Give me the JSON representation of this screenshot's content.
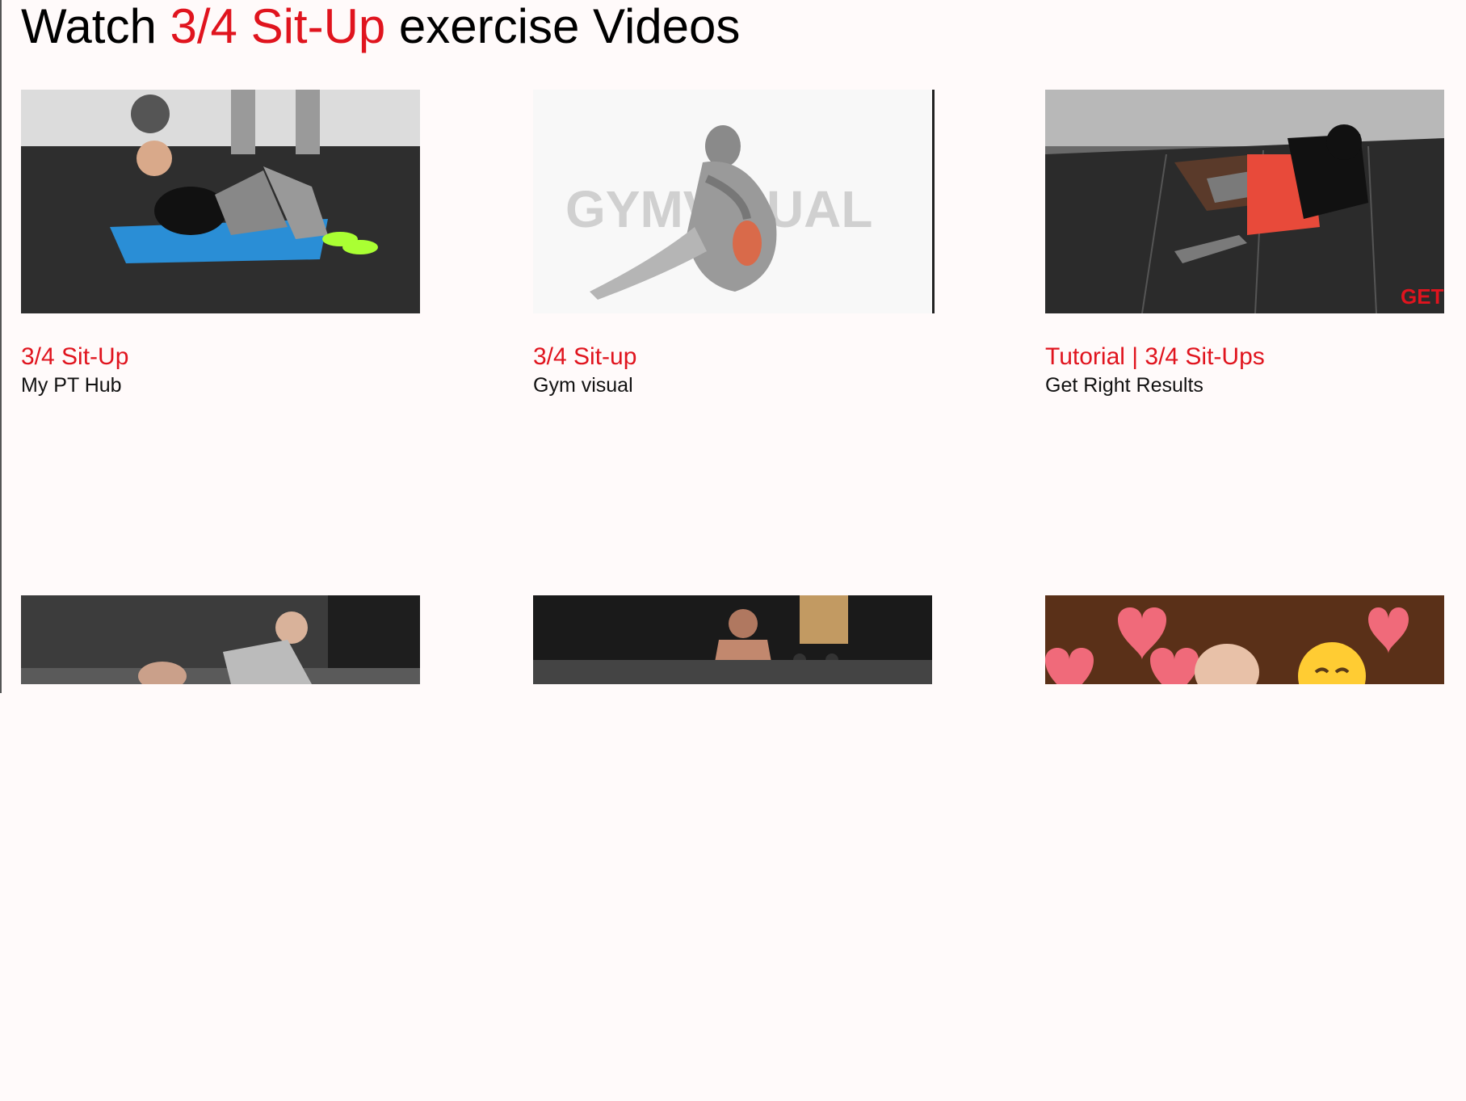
{
  "header": {
    "title_prefix": "Watch ",
    "title_accent": "3/4 Sit-Up",
    "title_suffix": " exercise Videos"
  },
  "videos": [
    {
      "title": "3/4 Sit-Up",
      "channel": "My PT Hub",
      "thumbnail": "man-situp-blue-mat"
    },
    {
      "title": "3/4 Sit-up",
      "channel": "Gym visual",
      "thumbnail": "anatomy-illustration"
    },
    {
      "title": "Tutorial | 3/4 Sit-Ups",
      "channel": "Get Right Results",
      "thumbnail": "man-situp-red-shorts"
    },
    {
      "title": "",
      "channel": "",
      "thumbnail": "man-situp-brick-wall"
    },
    {
      "title": "",
      "channel": "",
      "thumbnail": "man-situp-gym-dumbbells"
    },
    {
      "title": "",
      "channel": "",
      "thumbnail": "hearts-emoji-baby"
    }
  ],
  "thumb_text": {
    "gymvisual": "GYMVISUAL",
    "getright": "GET R"
  },
  "colors": {
    "accent": "#e0141e",
    "background": "#fffafa"
  }
}
